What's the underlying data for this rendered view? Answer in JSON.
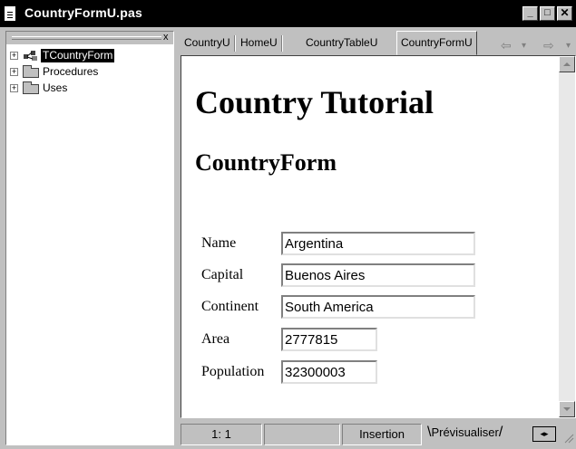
{
  "window": {
    "title": "CountryFormU.pas",
    "min_glyph": "_",
    "max_glyph": "□",
    "close_glyph": "✕"
  },
  "tree": {
    "close_glyph": "x",
    "items": [
      {
        "label": "TCountryForm",
        "icon": "form-icon",
        "selected": true
      },
      {
        "label": "Procedures",
        "icon": "folder-icon",
        "selected": false
      },
      {
        "label": "Uses",
        "icon": "folder-icon",
        "selected": false
      }
    ]
  },
  "tabs": [
    {
      "label": "CountryU"
    },
    {
      "label": "HomeU"
    },
    {
      "label": "CountryTableU"
    },
    {
      "label": "CountryFormU",
      "active": true
    }
  ],
  "nav": {
    "back_glyph": "⇦",
    "dropdown_glyph": "▾",
    "forward_glyph": "⇨"
  },
  "page": {
    "heading1": "Country Tutorial",
    "heading2": "CountryForm",
    "fields": [
      {
        "label": "Name",
        "value": "Argentina"
      },
      {
        "label": "Capital",
        "value": "Buenos Aires"
      },
      {
        "label": "Continent",
        "value": "South America"
      },
      {
        "label": "Area",
        "value": "2777815"
      },
      {
        "label": "Population",
        "value": "32300003"
      }
    ]
  },
  "status": {
    "position": "1:  1",
    "mode": "Insertion",
    "preview_tab": "Prévisualiser",
    "nav_glyphs": "◂▸"
  },
  "colors": {
    "titlebar": "#000000",
    "chrome": "#c0c0c0",
    "selection": "#000000"
  }
}
